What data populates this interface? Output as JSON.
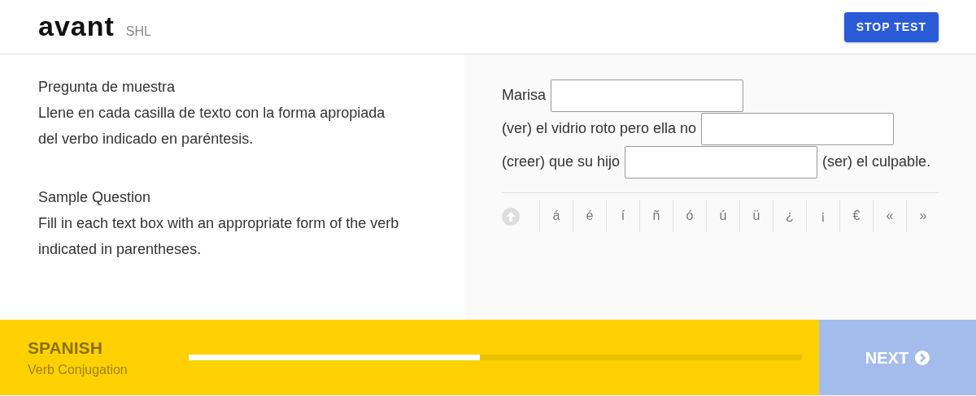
{
  "header": {
    "logo": "avant",
    "brand": "SHL",
    "stop_button": "STOP TEST"
  },
  "instructions": [
    {
      "title": "Pregunta de muestra",
      "text": "Llene en cada casilla de texto con la forma apropiada del verbo indicado en paréntesis."
    },
    {
      "title": "Sample Question",
      "text": "Fill in each text box with an appropriate form of the verb indicated in parentheses."
    }
  ],
  "sentence": [
    {
      "kind": "text",
      "text": "Marisa"
    },
    {
      "kind": "blank"
    },
    {
      "kind": "text",
      "text": "(ver) el vidrio roto pero ella no"
    },
    {
      "kind": "blank"
    },
    {
      "kind": "text",
      "text": "(creer) que su hijo"
    },
    {
      "kind": "blank"
    },
    {
      "kind": "text",
      "text": "(ser) el culpable."
    }
  ],
  "keys": [
    "á",
    "é",
    "í",
    "ñ",
    "ó",
    "ú",
    "ü",
    "¿",
    "¡",
    "€",
    "«",
    "»"
  ],
  "footer": {
    "language": "SPANISH",
    "section": "Verb Conjugation",
    "progress": {
      "level": 0.475
    },
    "next_button": {
      "label": "NEXT",
      "disabled": true
    }
  }
}
